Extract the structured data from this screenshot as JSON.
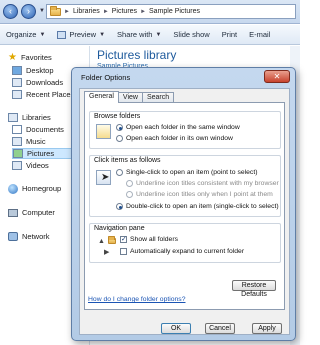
{
  "address_bar": {
    "crumbs": [
      "Libraries",
      "Pictures",
      "Sample Pictures"
    ]
  },
  "toolbar": {
    "items": [
      {
        "label": "Organize",
        "dropdown": true
      },
      {
        "label": "Preview",
        "dropdown": true
      },
      {
        "label": "Share with",
        "dropdown": true
      },
      {
        "label": "Slide show",
        "dropdown": false
      },
      {
        "label": "Print",
        "dropdown": false
      },
      {
        "label": "E-mail",
        "dropdown": false
      }
    ]
  },
  "nav_pane": {
    "favorites": "Favorites",
    "desktop": "Desktop",
    "downloads": "Downloads",
    "recent": "Recent Places",
    "libraries": "Libraries",
    "documents": "Documents",
    "music": "Music",
    "pictures": "Pictures",
    "videos": "Videos",
    "homegroup": "Homegroup",
    "computer": "Computer",
    "network": "Network"
  },
  "content": {
    "title": "Pictures library",
    "subtitle": "Sample Pictures"
  },
  "dialog": {
    "title": "Folder Options",
    "close_glyph": "✕",
    "tabs": [
      "General",
      "View",
      "Search"
    ],
    "active_tab": "General",
    "browse_folders": {
      "label": "Browse folders",
      "options": [
        "Open each folder in the same window",
        "Open each folder in its own window"
      ],
      "selected_index": 0
    },
    "click_items": {
      "label": "Click items as follows",
      "single_click": "Single-click to open an item (point to select)",
      "underline_consistent": "Underline icon titles consistent with my browser",
      "underline_point": "Underline icon titles only when I point at them",
      "double_click": "Double-click to open an item (single-click to select)",
      "selected": "double"
    },
    "navigation_pane": {
      "label": "Navigation pane",
      "show_all_folders": "Show all folders",
      "show_all_folders_checked": true,
      "auto_expand": "Automatically expand to current folder",
      "auto_expand_checked": false
    },
    "restore_defaults": "Restore Defaults",
    "help_link": "How do I change folder options?",
    "buttons": {
      "ok": "OK",
      "cancel": "Cancel",
      "apply": "Apply"
    }
  }
}
